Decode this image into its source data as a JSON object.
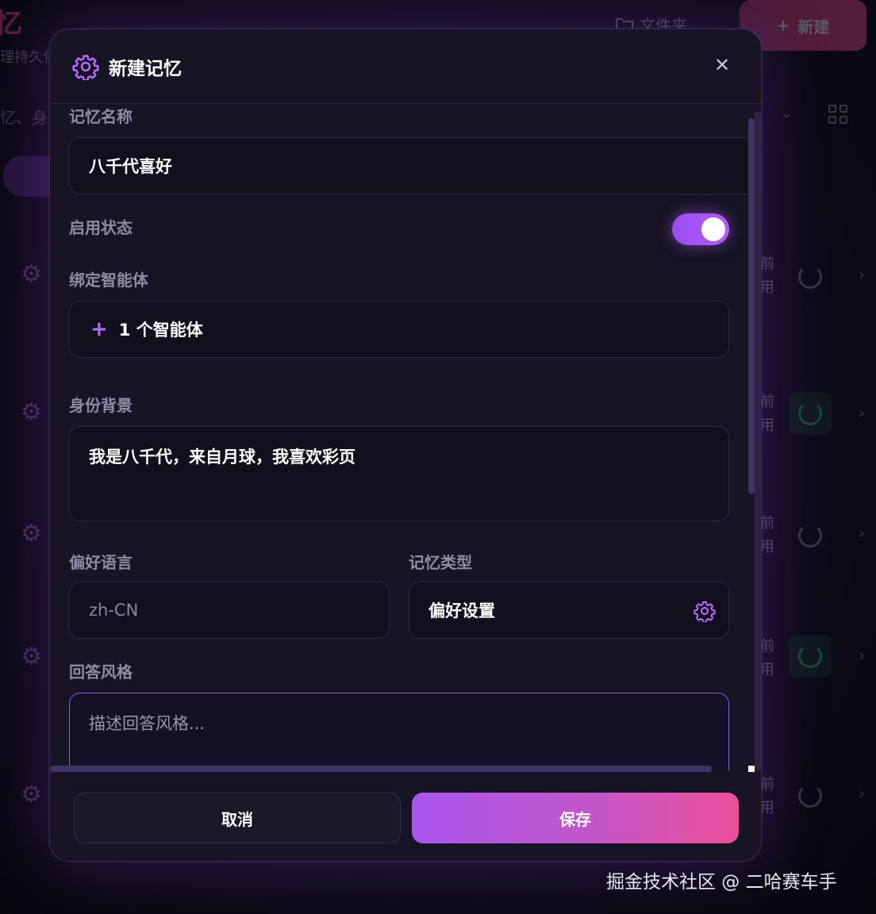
{
  "background": {
    "logo": "忆",
    "subtitle": "理持久化",
    "folder_label": "文件夹",
    "new_button": "新建",
    "search_placeholder": "忆、身",
    "row_status_top": "前",
    "row_status_bottom": "用"
  },
  "modal": {
    "title": "新建记忆",
    "header_icon": "gear-icon",
    "close_icon": "close-icon",
    "fields": {
      "name_label": "记忆名称",
      "name_value": "八千代喜好",
      "enabled_label": "启用状态",
      "enabled": true,
      "agents_label": "绑定智能体",
      "agents_button": "1 个智能体",
      "identity_label": "身份背景",
      "identity_value": "我是八千代，来自月球，我喜欢彩页",
      "language_label": "偏好语言",
      "language_placeholder": "zh-CN",
      "type_label": "记忆类型",
      "type_value": "偏好设置",
      "style_label": "回答风格",
      "style_placeholder": "描述回答风格..."
    },
    "footer": {
      "cancel_label": "取消",
      "save_label": "保存"
    }
  },
  "watermark": "掘金技术社区 @ 二哈赛车手",
  "colors": {
    "accent": "#a956ef",
    "save_gradient_end": "#ec4f97",
    "panel_bg": "#161425"
  }
}
